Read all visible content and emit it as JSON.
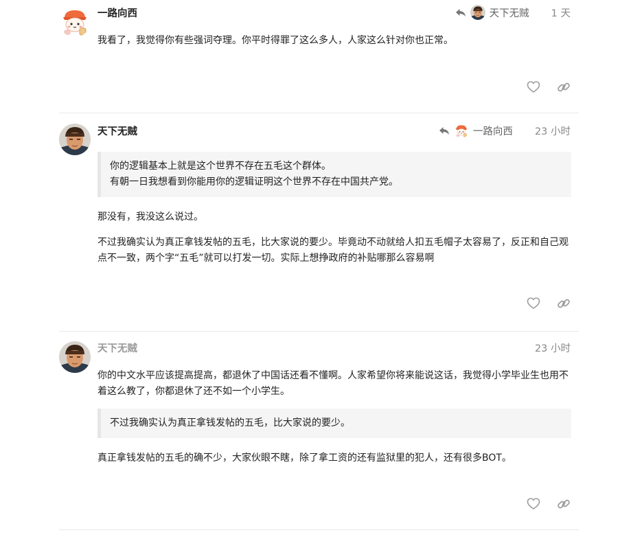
{
  "posts": [
    {
      "username": "一路向西",
      "reply_to": "天下无贼",
      "time": "1 天",
      "paragraphs": [
        "我看了，我觉得你有些强词夺理。你平时得罪了这么多人，人家这么针对你也正常。"
      ]
    },
    {
      "username": "天下无贼",
      "reply_to": "一路向西",
      "time": "23 小时",
      "quote": [
        "你的逻辑基本上就是这个世界不存在五毛这个群体。",
        "有朝一日我想看到你能用你的逻辑证明这个世界不存在中国共产党。"
      ],
      "paragraphs": [
        "那没有，我没这么说过。",
        "不过我确实认为真正拿钱发帖的五毛，比大家说的要少。毕竟动不动就给人扣五毛帽子太容易了，反正和自己观点不一致，两个字“五毛”就可以打发一切。实际上想挣政府的补贴哪那么容易啊"
      ]
    },
    {
      "username": "天下无贼",
      "time": "23 小时",
      "paragraph_before": "你的中文水平应该提高提高，都退休了中国话还看不懂啊。人家希望你将来能说这话，我觉得小学毕业生也用不着这么教了，你都退休了还不如一个小学生。",
      "quote": "不过我确实认为真正拿钱发帖的五毛，比大家说的要少。",
      "paragraph_after": "真正拿钱发帖的五毛的确不少，大家伙眼不瞎，除了拿工资的还有监狱里的犯人，还有很多BOT。"
    }
  ],
  "icons": {
    "reply_arrow": "reply-arrow-icon",
    "like": "heart-icon",
    "link": "link-icon"
  },
  "colors": {
    "avatar_background": "#f3f3f3",
    "quote_background": "#f5f5f5",
    "quote_border": "#e6e6e6",
    "icon_gray": "#9e9e9e"
  }
}
